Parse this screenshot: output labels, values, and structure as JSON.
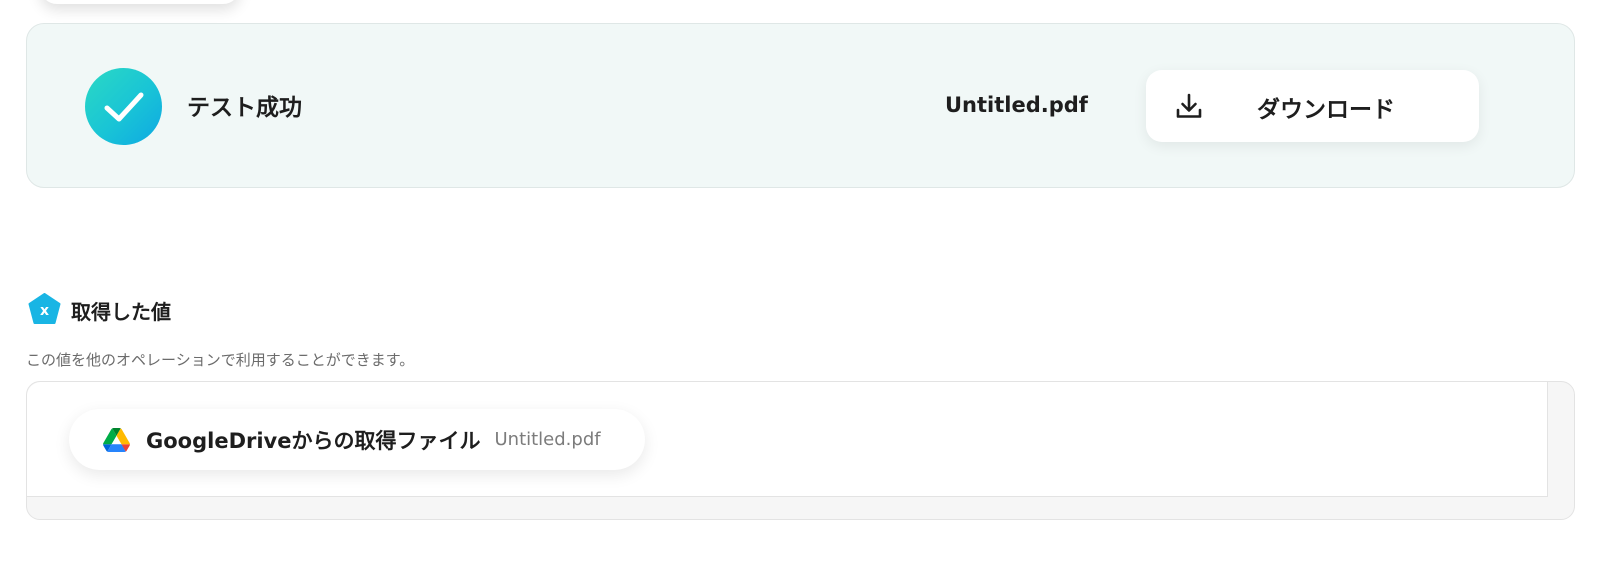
{
  "result": {
    "status_label": "テスト成功",
    "file_name": "Untitled.pdf",
    "download_label": "ダウンロード",
    "icons": {
      "status": "check-circle-icon",
      "download": "download-icon"
    },
    "colors": {
      "card_bg": "#f1f8f7",
      "success_gradient_start": "#2bd9c4",
      "success_gradient_end": "#0ea8e3"
    }
  },
  "acquired": {
    "title": "取得した値",
    "description": "この値を他のオペレーションで利用することができます。",
    "icon": "variable-icon",
    "accent_color": "#19b5e4",
    "values": [
      {
        "label": "GoogleDriveからの取得ファイル",
        "value": "Untitled.pdf",
        "icon": "google-drive-icon"
      }
    ]
  }
}
